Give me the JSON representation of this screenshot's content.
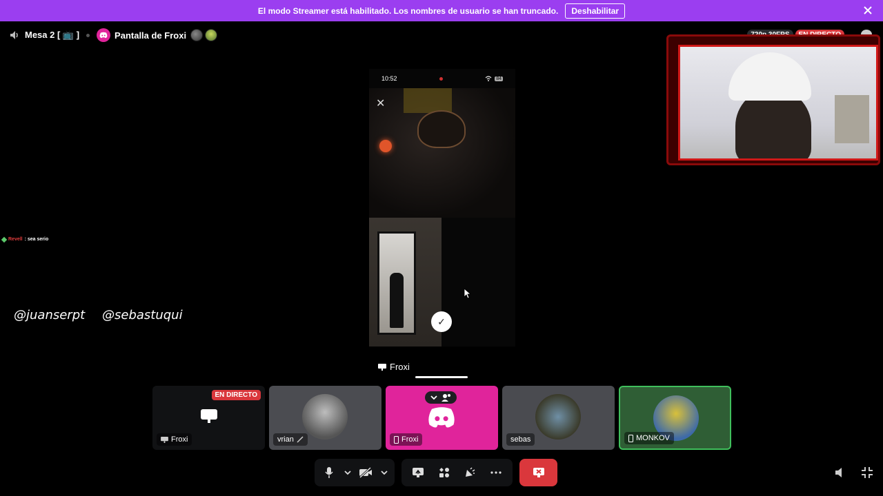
{
  "banner": {
    "text": "El modo Streamer está habilitado. Los nombres de usuario se han truncado.",
    "button": "Deshabilitar"
  },
  "topbar": {
    "channel": "Mesa 2 [ 📺 ]",
    "stream_title": "Pantalla de Froxi"
  },
  "stream": {
    "quality": "720p 30FPS",
    "live": "EN DIRECTO"
  },
  "screenshare": {
    "phone_time": "10:52",
    "battery": "84",
    "check": "✓",
    "close": "✕"
  },
  "overlays": {
    "chat_user": "Revell",
    "chat_text": ": sea serio",
    "handle_left": "@juanserpt",
    "handle_right": "@sebastuqui"
  },
  "focus": {
    "label": "Froxi"
  },
  "tiles": [
    {
      "name": "Froxi",
      "badge": "EN DIRECTO"
    },
    {
      "name": "vrian"
    },
    {
      "name": "Froxi"
    },
    {
      "name": "sebas"
    },
    {
      "name": "MONKOV"
    }
  ],
  "colors": {
    "banner": "#9b3ef0",
    "live": "#da373c",
    "discord_pink": "#e0249b",
    "speaking": "#3fbf5c"
  }
}
